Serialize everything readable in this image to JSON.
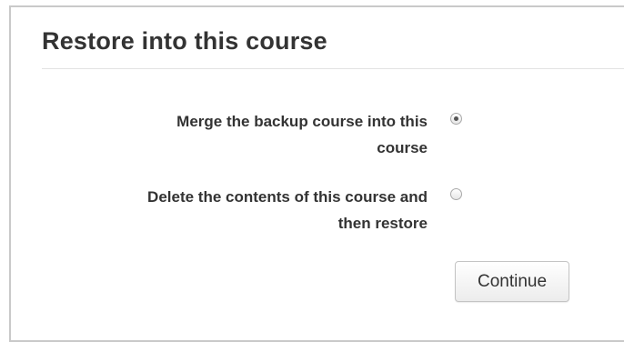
{
  "form": {
    "title": "Restore into this course",
    "options": [
      {
        "label_line1": "Merge the backup course into this",
        "label_line2": "course",
        "selected": true
      },
      {
        "label_line1": "Delete the contents of this course and",
        "label_line2": "then restore",
        "selected": false
      }
    ],
    "continue_label": "Continue"
  },
  "colors": {
    "text": "#333333",
    "border": "#c9c9c9",
    "divider": "#e3e3e3"
  }
}
